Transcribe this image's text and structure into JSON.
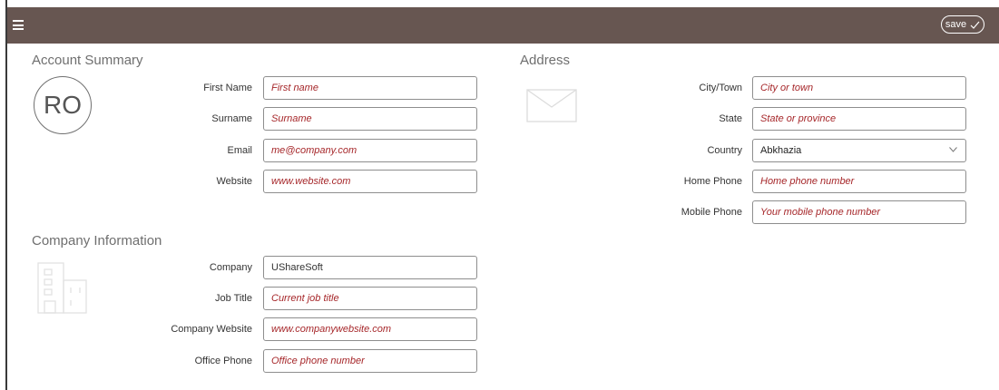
{
  "toolbar": {
    "menu_icon": "hamburger-menu-icon",
    "save_label": "save",
    "save_icon": "checkmark-icon"
  },
  "account_summary": {
    "title": "Account Summary",
    "avatar_initials": "RO",
    "fields": [
      {
        "label": "First Name",
        "value": "",
        "placeholder": "First name"
      },
      {
        "label": "Surname",
        "value": "",
        "placeholder": "Surname"
      },
      {
        "label": "Email",
        "value": "",
        "placeholder": "me@company.com"
      },
      {
        "label": "Website",
        "value": "",
        "placeholder": "www.website.com"
      }
    ]
  },
  "company_information": {
    "title": "Company Information",
    "icon": "building-icon",
    "fields": [
      {
        "label": "Company",
        "value": "UShareSoft",
        "placeholder": ""
      },
      {
        "label": "Job Title",
        "value": "",
        "placeholder": "Current job title"
      },
      {
        "label": "Company Website",
        "value": "",
        "placeholder": "www.companywebsite.com"
      },
      {
        "label": "Office Phone",
        "value": "",
        "placeholder": "Office phone number"
      }
    ]
  },
  "address": {
    "title": "Address",
    "icon": "envelope-icon",
    "city": {
      "label": "City/Town",
      "value": "",
      "placeholder": "City or town"
    },
    "state": {
      "label": "State",
      "value": "",
      "placeholder": "State or province"
    },
    "country": {
      "label": "Country",
      "selected": "Abkhazia"
    },
    "home_phone": {
      "label": "Home Phone",
      "value": "",
      "placeholder": "Home phone number"
    },
    "mobile_phone": {
      "label": "Mobile Phone",
      "value": "",
      "placeholder": "Your mobile phone number"
    }
  },
  "colors": {
    "topbar": "#675651",
    "placeholder": "#a6272a"
  }
}
